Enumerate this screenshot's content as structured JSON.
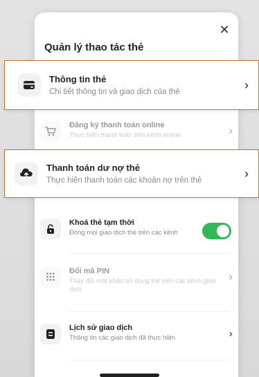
{
  "sheet": {
    "title": "Quản lý thao tác thẻ",
    "close_glyph": "✕"
  },
  "items": [
    {
      "title": "Thông tin thẻ",
      "subtitle": "Chi tiết thông tin và giao dịch của thẻ",
      "icon": "card-icon",
      "highlighted": true
    },
    {
      "title": "Đăng ký thanh toán online",
      "subtitle": "Thực hiện thanh toán trên kênh online",
      "icon": "cart-icon",
      "dimmed": true
    },
    {
      "title": "Thanh toán dư nợ thẻ",
      "subtitle": "Thực hiện thanh toán các khoản nợ trên thẻ",
      "icon": "upload-icon",
      "highlighted": true
    },
    {
      "title": "Khoá thẻ tạm thời",
      "subtitle": "Đóng mọi giao dịch thẻ trên các kênh",
      "icon": "lock-icon",
      "toggle_on": true
    },
    {
      "title": "Đổi mã PIN",
      "subtitle": "Thay đổi mật khẩu sử dụng thẻ trên các kênh giao dịch",
      "icon": "keypad-icon",
      "dimmed": true
    },
    {
      "title": "Lịch sử giao dịch",
      "subtitle": "Thông tin các giao dịch đã thực hiện",
      "icon": "receipt-icon"
    }
  ],
  "chevron": "›",
  "colors": {
    "accent_green": "#34b759",
    "highlight_border": "#c8702a"
  }
}
